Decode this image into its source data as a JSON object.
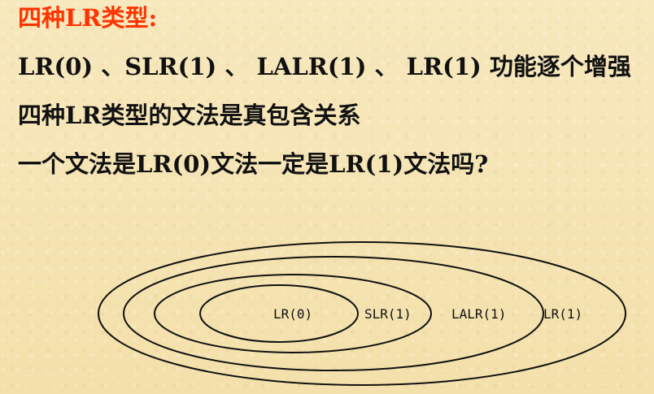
{
  "title": "四种LR类型:",
  "lines": [
    "LR(0) 、SLR(1) 、 LALR(1) 、 LR(1) 功能逐个增强",
    "四种LR类型的文法是真包含关系",
    "一个文法是LR(0)文法一定是LR(1)文法吗?"
  ],
  "diagram": {
    "labels": [
      "LR(0)",
      "SLR(1)",
      "LALR(1)",
      "LR(1)"
    ],
    "colors": {
      "title": "#ff3300",
      "highlight": "#ff0000",
      "default": "#111111"
    }
  }
}
